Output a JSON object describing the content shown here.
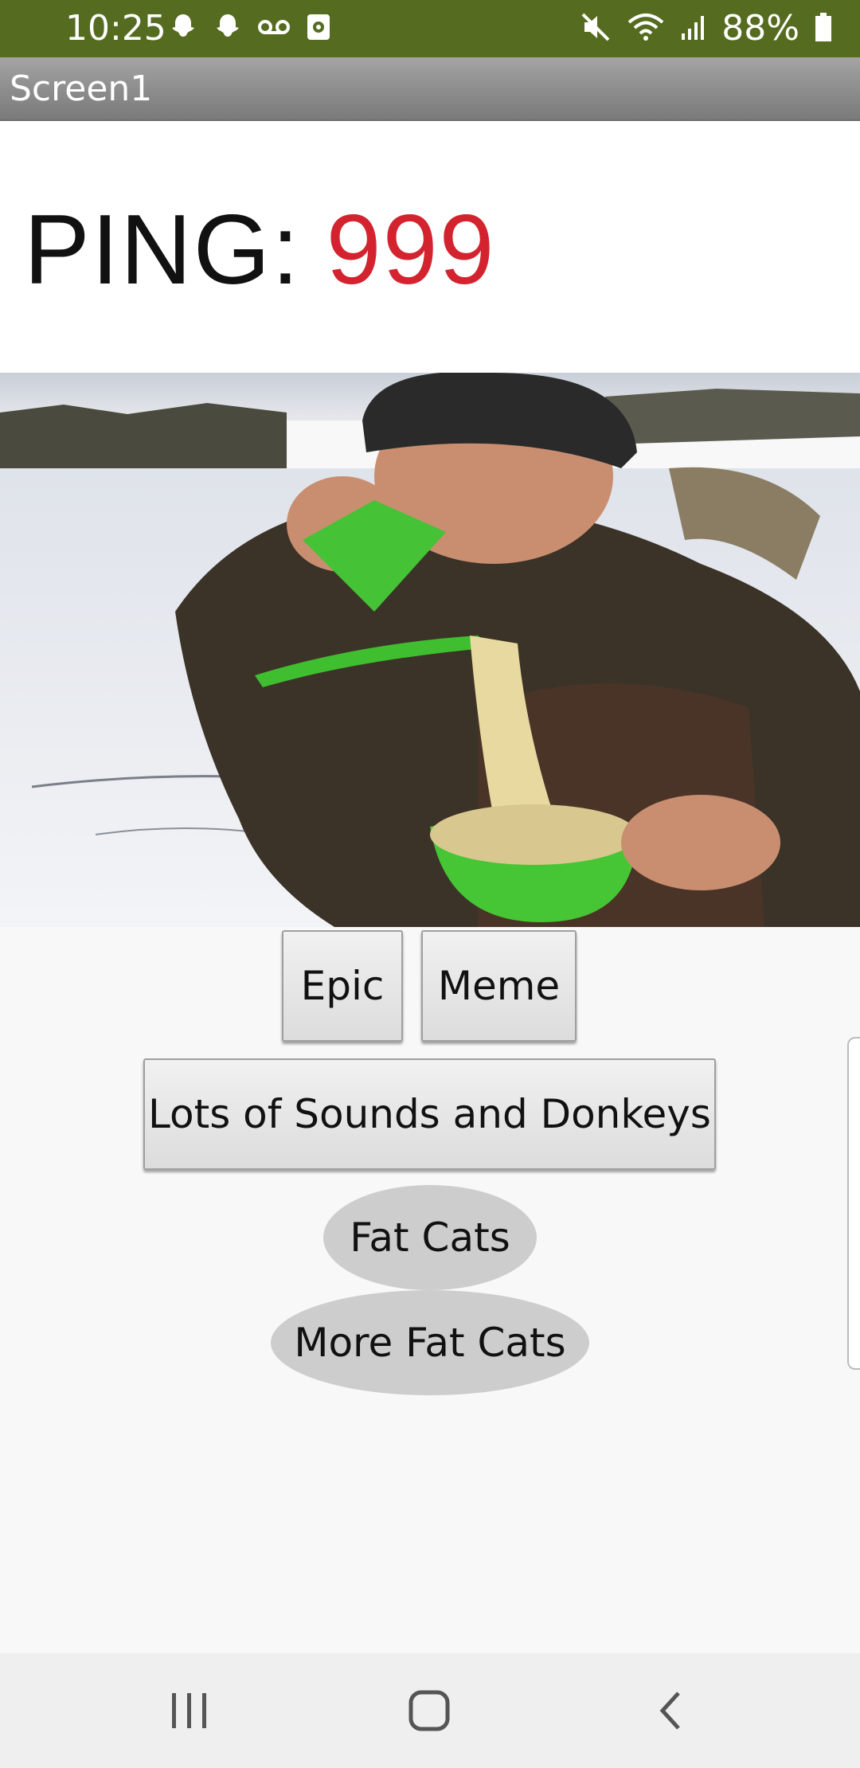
{
  "status_bar": {
    "time": "10:25",
    "battery": "88%",
    "icons": [
      "snapchat-icon",
      "snapchat-icon",
      "voicemail-icon",
      "screen-record-icon",
      "mute-icon",
      "wifi-icon",
      "signal-icon",
      "battery-icon"
    ],
    "color": "#556b1f"
  },
  "title_bar": {
    "title": "Screen1"
  },
  "ping": {
    "label": "PING:",
    "value": "999",
    "value_color": "#d3232f"
  },
  "buttons": {
    "epic": "Epic",
    "meme": "Meme",
    "sounds": "Lots of Sounds and Donkeys",
    "fat_cats": "Fat Cats",
    "more_fat_cats": "More Fat Cats"
  },
  "nav_bar": {
    "icons": [
      "recents-icon",
      "home-icon",
      "back-icon"
    ]
  }
}
